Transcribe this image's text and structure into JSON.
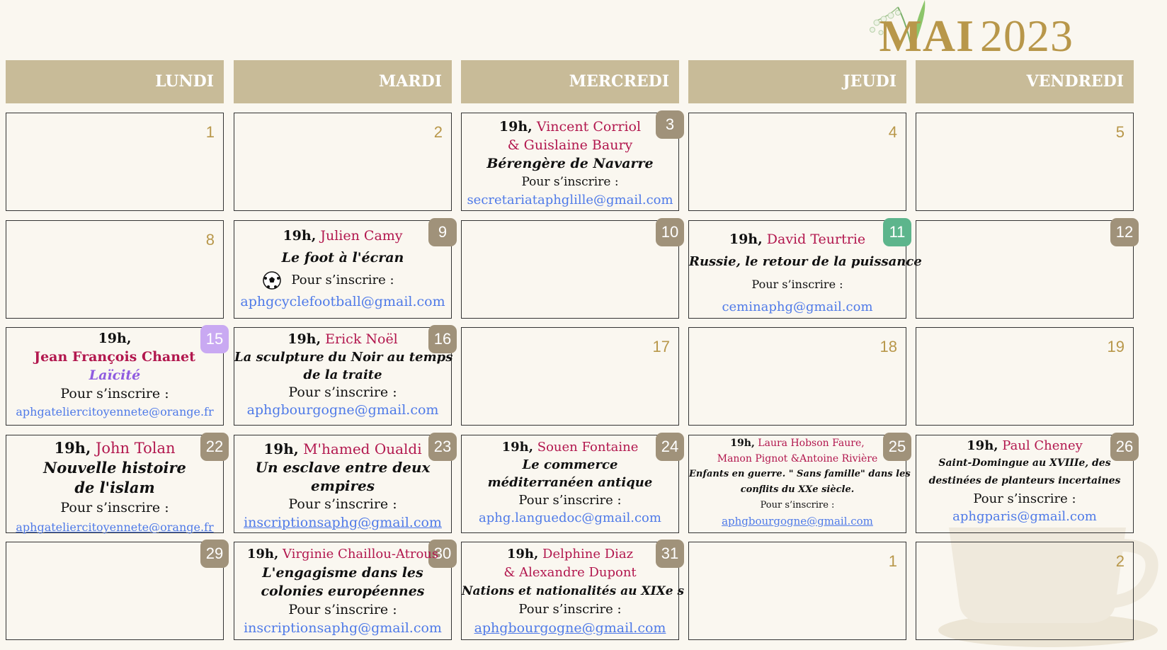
{
  "header": {
    "month": "MAI",
    "year": "2023"
  },
  "weekdays": [
    "LUNDI",
    "MARDI",
    "MERCREDI",
    "JEUDI",
    "VENDREDI"
  ],
  "days": {
    "d1": "1",
    "d2": "2",
    "d3": "3",
    "d4": "4",
    "d5": "5",
    "d8": "8",
    "d9": "9",
    "d10": "10",
    "d11": "11",
    "d12": "12",
    "d15": "15",
    "d16": "16",
    "d17": "17",
    "d18": "18",
    "d19": "19",
    "d22": "22",
    "d23": "23",
    "d24": "24",
    "d25": "25",
    "d26": "26",
    "d29": "29",
    "d30": "30",
    "d31": "31",
    "n1": "1",
    "n2": "2"
  },
  "events": {
    "e3": {
      "time": "19h,",
      "speaker": "Vincent Corriol",
      "speaker2": "& Guislaine Baury",
      "title": "Bérengère de Navarre",
      "register": "Pour s’inscrire :",
      "email": "secretariataphglille@gmail.com"
    },
    "e9": {
      "time": "19h,",
      "speaker": "Julien Camy",
      "title": "Le foot à l'écran",
      "register": "Pour s’inscrire :",
      "email": "aphgcyclefootball@gmail.com"
    },
    "e11": {
      "time": "19h,",
      "speaker": "David Teurtrie",
      "title": "Russie, le retour de la puissance",
      "register": "Pour s’inscrire :",
      "email": "ceminaphg@gmail.com"
    },
    "e15": {
      "time": "19h,",
      "speaker": "Jean François Chanet",
      "title": "Laïcité",
      "register": "Pour s’inscrire :",
      "email": "aphgateliercitoyennete@orange.fr"
    },
    "e16": {
      "time": "19h,",
      "speaker": "Erick Noël",
      "title1": "La sculpture du Noir au temps",
      "title2": "de la traite",
      "register": "Pour s’inscrire :",
      "email": "aphgbourgogne@gmail.com"
    },
    "e22": {
      "time": "19h,",
      "speaker": "John Tolan",
      "title1": "Nouvelle histoire",
      "title2": "de l'islam",
      "register": "Pour s’inscrire :",
      "email": "aphgateliercitoyennete@orange.fr"
    },
    "e23": {
      "time": "19h,",
      "speaker": "M'hamed Oualdi",
      "title1": "Un esclave entre deux",
      "title2": "empires",
      "register": "Pour s’inscrire :",
      "email": "inscriptionsaphg@gmail.com"
    },
    "e24": {
      "time": "19h,",
      "speaker": "Souen Fontaine",
      "title1": "Le commerce",
      "title2": "méditerranéen antique",
      "register": "Pour s’inscrire :",
      "email": "aphg.languedoc@gmail.com"
    },
    "e25": {
      "time": "19h,",
      "speaker": "Laura Hobson Faure,",
      "speaker2": "Manon Pignot &Antoine Rivière",
      "title1": "Enfants en guerre. \" Sans famille\" dans les",
      "title2": "conflits du XXe siècle.",
      "register": "Pour s’inscrire :",
      "email": "aphgbourgogne@gmail.com"
    },
    "e26": {
      "time": "19h,",
      "speaker": "Paul Cheney",
      "title1": "Saint-Domingue au XVIIIe, des",
      "title2": "destinées de planteurs incertaines",
      "register": "Pour s’inscrire :",
      "email": "aphgparis@gmail.com"
    },
    "e30": {
      "time": "19h,",
      "speaker": "Virginie Chaillou-Atrous",
      "title1": "L'engagisme dans les",
      "title2": "colonies européennes",
      "register": "Pour s’inscrire :",
      "email": "inscriptionsaphg@gmail.com"
    },
    "e31": {
      "time": "19h,",
      "speaker": "Delphine Diaz",
      "speaker2": "& Alexandre Dupont",
      "title": "Nations et nationalités au XIXe s",
      "register": "Pour s’inscrire :",
      "email": "aphgbourgogne@gmail.com"
    }
  },
  "colors": {
    "gold": "#b8974a",
    "header_bg": "#c8bb98",
    "badge": "#a0927a",
    "badge_green": "#5db58c",
    "badge_lavender": "#c9a9f2",
    "speaker": "#b2174e",
    "email": "#4f7ae8"
  }
}
